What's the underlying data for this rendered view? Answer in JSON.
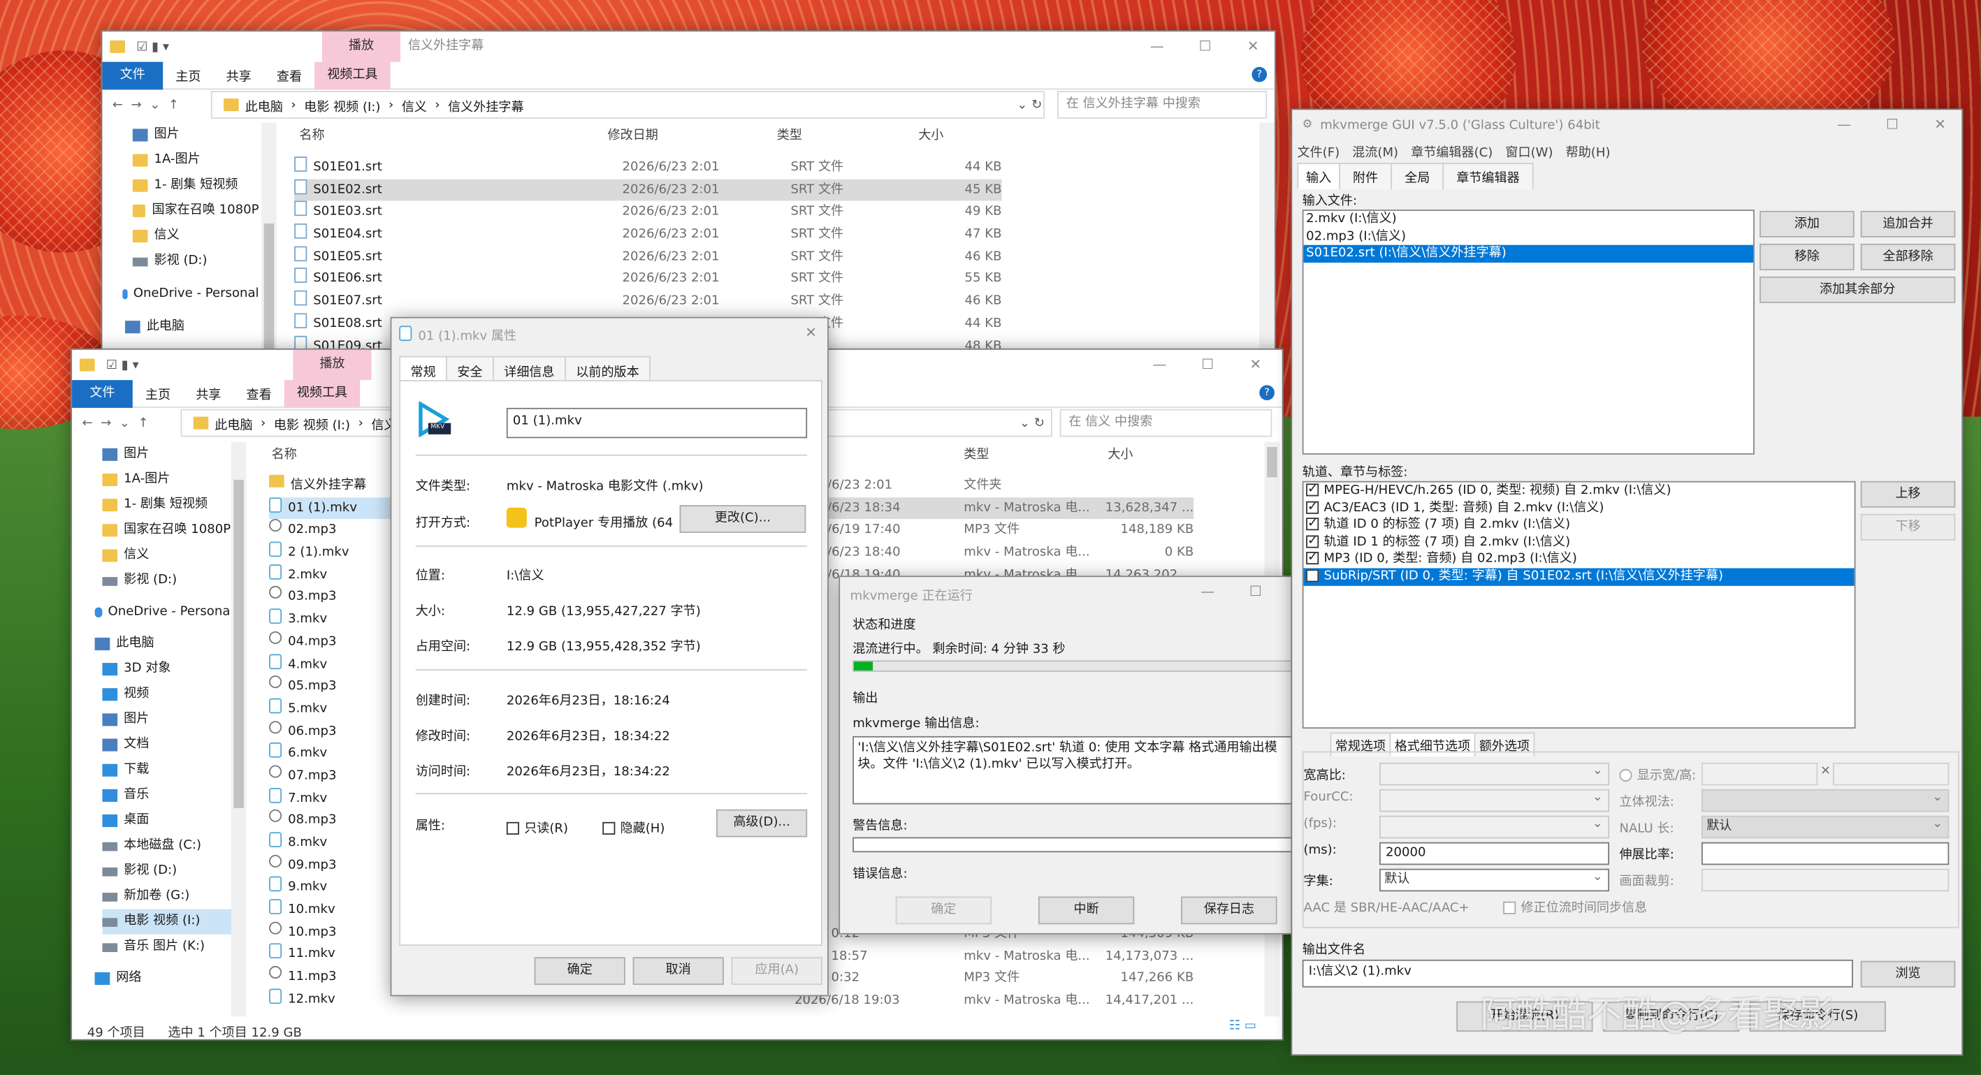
{
  "explorer1": {
    "title": "信义外挂字幕",
    "context_tab": "播放",
    "ribbon": [
      "文件",
      "主页",
      "共享",
      "查看",
      "视频工具"
    ],
    "path": [
      "此电脑",
      "电影 视频 (I:)",
      "信义",
      "信义外挂字幕"
    ],
    "search_placeholder": "在 信义外挂字幕 中搜索",
    "nav": [
      "图片",
      "1A-图片",
      "1- 剧集 短视频",
      "国家在召唤 1080P",
      "信义",
      "影视 (D:)",
      "OneDrive - Personal",
      "此电脑"
    ],
    "headers": [
      "名称",
      "修改日期",
      "类型",
      "大小"
    ],
    "files": [
      [
        "S01E01.srt",
        "2026/6/23 2:01",
        "SRT 文件",
        "44 KB"
      ],
      [
        "S01E02.srt",
        "2026/6/23 2:01",
        "SRT 文件",
        "45 KB"
      ],
      [
        "S01E03.srt",
        "2026/6/23 2:01",
        "SRT 文件",
        "49 KB"
      ],
      [
        "S01E04.srt",
        "2026/6/23 2:01",
        "SRT 文件",
        "47 KB"
      ],
      [
        "S01E05.srt",
        "2026/6/23 2:01",
        "SRT 文件",
        "46 KB"
      ],
      [
        "S01E06.srt",
        "2026/6/23 2:01",
        "SRT 文件",
        "55 KB"
      ],
      [
        "S01E07.srt",
        "2026/6/23 2:01",
        "SRT 文件",
        "46 KB"
      ],
      [
        "S01E08.srt",
        "2026/6/23 2:01",
        "SRT 文件",
        "44 KB"
      ],
      [
        "S01E09.srt",
        "",
        "",
        "48 KB"
      ]
    ]
  },
  "explorer2": {
    "context_tab": "播放",
    "ribbon": [
      "文件",
      "主页",
      "共享",
      "查看",
      "视频工具"
    ],
    "path": [
      "此电脑",
      "电影 视频 (I:)",
      "信义"
    ],
    "search_placeholder": "在 信义 中搜索",
    "nav": [
      "图片",
      "1A-图片",
      "1- 剧集 短视频",
      "国家在召唤 1080P",
      "信义",
      "影视 (D:)",
      "OneDrive - Personal",
      "此电脑",
      "3D 对象",
      "视频",
      "图片",
      "文档",
      "下载",
      "音乐",
      "桌面",
      "本地磁盘 (C:)",
      "影视 (D:)",
      "新加卷 (G:)",
      "电影 视频 (I:)",
      "音乐 图片 (K:)",
      "网络"
    ],
    "name_header": "名称",
    "type_header": "类型",
    "size_header": "大小",
    "names": [
      "信义外挂字幕",
      "01 (1).mkv",
      "02.mp3",
      "2 (1).mkv",
      "2.mkv",
      "03.mp3",
      "3.mkv",
      "04.mp3",
      "4.mkv",
      "05.mp3",
      "5.mkv",
      "06.mp3",
      "6.mkv",
      "07.mp3",
      "7.mkv",
      "08.mp3",
      "8.mkv",
      "09.mp3",
      "9.mkv",
      "10.mkv",
      "10.mp3",
      "11.mkv",
      "11.mp3",
      "12.mkv"
    ],
    "right_rows": [
      [
        "/6/23 2:01",
        "文件夹",
        ""
      ],
      [
        "/6/23 18:34",
        "mkv - Matroska 电...",
        "13,628,347 ..."
      ],
      [
        "/6/19 17:40",
        "MP3 文件",
        "148,189 KB"
      ],
      [
        "/6/23 18:40",
        "mkv - Matroska 电...",
        "0 KB"
      ],
      [
        "/6/18 19:40",
        "mkv - Matroska 电...",
        "14,263,202 ..."
      ]
    ],
    "bottom_rows": [
      [
        "/6/23 0:12",
        "MP3 文件",
        "144,509 KB"
      ],
      [
        "/6/18 18:57",
        "mkv - Matroska 电...",
        "14,173,073 ..."
      ],
      [
        "/6/23 0:32",
        "MP3 文件",
        "147,266 KB"
      ],
      [
        "2026/6/18 19:03",
        "mkv - Matroska 电...",
        "14,417,201 ..."
      ]
    ],
    "status": [
      "49 个项目",
      "选中 1 个项目  12.9 GB"
    ]
  },
  "props": {
    "title": "01 (1).mkv 属性",
    "tabs": [
      "常规",
      "安全",
      "详细信息",
      "以前的版本"
    ],
    "filename": "01 (1).mkv",
    "labels": {
      "type": "文件类型:",
      "open": "打开方式:",
      "loc": "位置:",
      "size": "大小:",
      "disk": "占用空间:",
      "created": "创建时间:",
      "modified": "修改时间:",
      "accessed": "访问时间:",
      "attr": "属性:"
    },
    "values": {
      "type": "mkv - Matroska 电影文件 (.mkv)",
      "open": "PotPlayer 专用播放 (64",
      "loc": "I:\\信义",
      "size": "12.9 GB (13,955,427,227 字节)",
      "disk": "12.9 GB (13,955,428,352 字节)",
      "created": "2026年6月23日，18:16:24",
      "modified": "2026年6月23日，18:34:22",
      "accessed": "2026年6月23日，18:34:22"
    },
    "change_btn": "更改(C)...",
    "readonly": "只读(R)",
    "hidden": "隐藏(H)",
    "advanced": "高级(D)...",
    "ok": "确定",
    "cancel": "取消",
    "apply": "应用(A)",
    "icon_text": "MKV"
  },
  "progress": {
    "title": "mkvmerge 正在运行",
    "group": "状态和进度",
    "status": "混流进行中。 剩余时间: 4 分钟 33 秒",
    "percent": 4,
    "output_label": "输出",
    "info_label": "mkvmerge 输出信息:",
    "info_text": "'I:\\信义\\信义外挂字幕\\S01E02.srt' 轨道 0: 使用 文本字幕 格式通用输出模块。文件 'I:\\信义\\2 (1).mkv' 已以写入模式打开。",
    "warn_label": "警告信息:",
    "err_label": "错误信息:",
    "btn_ok": "确定",
    "btn_abort": "中断",
    "btn_save": "保存日志"
  },
  "mkv": {
    "title": "mkvmerge GUI v7.5.0 ('Glass Culture') 64bit",
    "menu": [
      "文件(F)",
      "混流(M)",
      "章节编辑器(C)",
      "窗口(W)",
      "帮助(H)"
    ],
    "tabs": [
      "输入",
      "附件",
      "全局",
      "章节编辑器"
    ],
    "input_label": "输入文件:",
    "inputs": [
      "2.mkv (I:\\信义)",
      "02.mp3 (I:\\信义)",
      "S01E02.srt (I:\\信义\\信义外挂字幕)"
    ],
    "btn_add": "添加",
    "btn_append": "追加合并",
    "btn_remove": "移除",
    "btn_remove_all": "全部移除",
    "btn_add_other": "添加其余部分",
    "tracks_label": "轨道、章节与标签:",
    "tracks": [
      "MPEG-H/HEVC/h.265 (ID 0, 类型: 视频) 自 2.mkv (I:\\信义)",
      "AC3/EAC3 (ID 1, 类型: 音频) 自 2.mkv (I:\\信义)",
      "轨道 ID 0 的标签 (7 项) 自 2.mkv (I:\\信义)",
      "轨道 ID 1 的标签 (7 项) 自 2.mkv (I:\\信义)",
      "MP3 (ID 0, 类型: 音频) 自 02.mp3 (I:\\信义)",
      "SubRip/SRT (ID 0, 类型: 字幕) 自 S01E02.srt (I:\\信义\\信义外挂字幕)"
    ],
    "btn_up": "上移",
    "btn_down": "下移",
    "opt_tabs": [
      "常规选项",
      "格式细节选项",
      "额外选项"
    ],
    "opt_labels": {
      "aspect": "宽高比:",
      "fourcc": "FourCC:",
      "fps": "(fps):",
      "delay": "(ms):",
      "charset": "字集:",
      "display": "显示宽/高:",
      "stereo": "立体视法:",
      "nalu": "NALU 长:",
      "stretch": "伸展比率:",
      "crop": "画面裁剪:",
      "aac": "AAC 是 SBR/HE-AAC/AAC+",
      "fix": "修正位流时间同步信息"
    },
    "delay_value": "20000",
    "charset_value": "默认",
    "nalu_value": "默认",
    "out_label": "输出文件名",
    "out_value": "I:\\信义\\2 (1).mkv",
    "browse": "浏览",
    "btn_start": "开始混流(R)",
    "btn_copy": "复制到命令行(C)",
    "btn_save": "保存命令行(S)"
  },
  "watermark": "阿酷酷不酷@多看聚影"
}
